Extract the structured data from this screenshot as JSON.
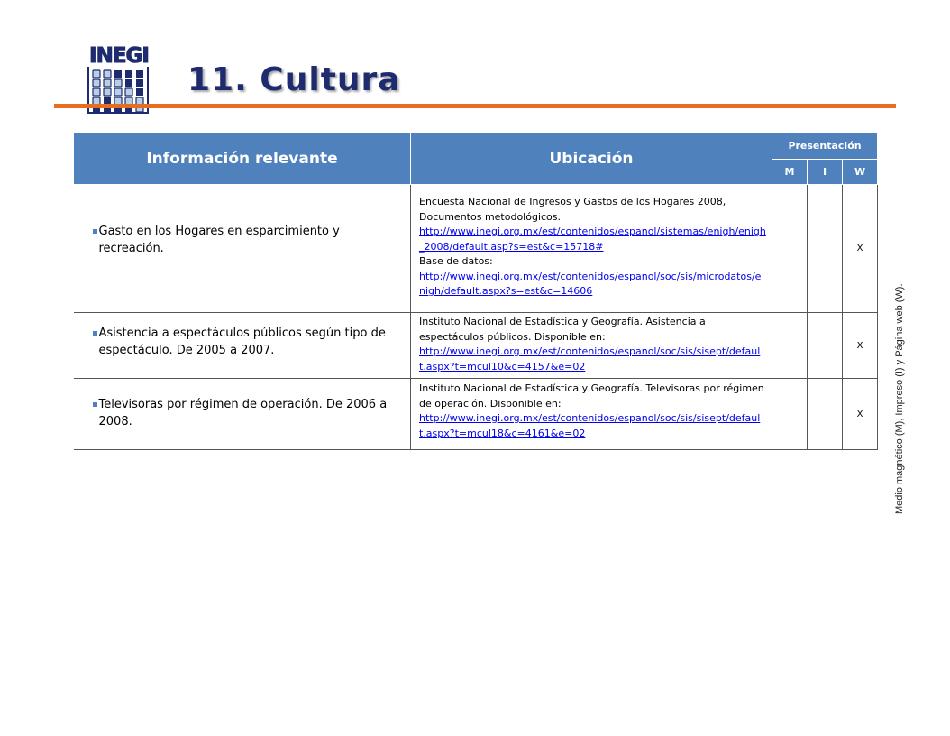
{
  "logo": {
    "word": "INEGI"
  },
  "title": "11. Cultura",
  "table": {
    "headers": {
      "info": "Información relevante",
      "ubicacion": "Ubicación",
      "presentacion": "Presentación",
      "m": "M",
      "i": "I",
      "w": "W"
    },
    "rows": [
      {
        "info": "Gasto en los Hogares en esparcimiento y recreación.",
        "ubicacion_text1": "Encuesta Nacional de Ingresos y Gastos de los Hogares 2008, Documentos metodológicos.",
        "link1": "http://www.inegi.org.mx/est/contenidos/espanol/sistemas/enigh/enigh_2008/default.asp?s=est&c=15718#",
        "ubicacion_text2": "Base de datos:",
        "link2": "http://www.inegi.org.mx/est/contenidos/espanol/soc/sis/microdatos/enigh/default.aspx?s=est&c=14606",
        "m": "",
        "i": "",
        "w": "X"
      },
      {
        "info": "Asistencia a espectáculos públicos según tipo de espectáculo. De 2005 a 2007.",
        "ubicacion_text1": "Instituto Nacional de Estadística y Geografía. Asistencia a espectáculos públicos. Disponible en:",
        "link1": "http://www.inegi.org.mx/est/contenidos/espanol/soc/sis/sisept/default.aspx?t=mcul10&c=4157&e=02",
        "m": "",
        "i": "",
        "w": "X"
      },
      {
        "info": "Televisoras por régimen de operación. De 2006 a 2008.",
        "ubicacion_text1": "Instituto Nacional de Estadística y Geografía. Televisoras por régimen de operación. Disponible en:",
        "link1": "http://www.inegi.org.mx/est/contenidos/espanol/soc/sis/sisept/default.aspx?t=mcul18&c=4161&e=02",
        "m": "",
        "i": "",
        "w": "X"
      }
    ]
  },
  "side_note": "Medio magnético (M), Impreso (I) y Página web (W).",
  "colors": {
    "header_blue": "#4f81bd",
    "title_navy": "#1e2b6e",
    "rule_orange": "#e86d1f"
  }
}
